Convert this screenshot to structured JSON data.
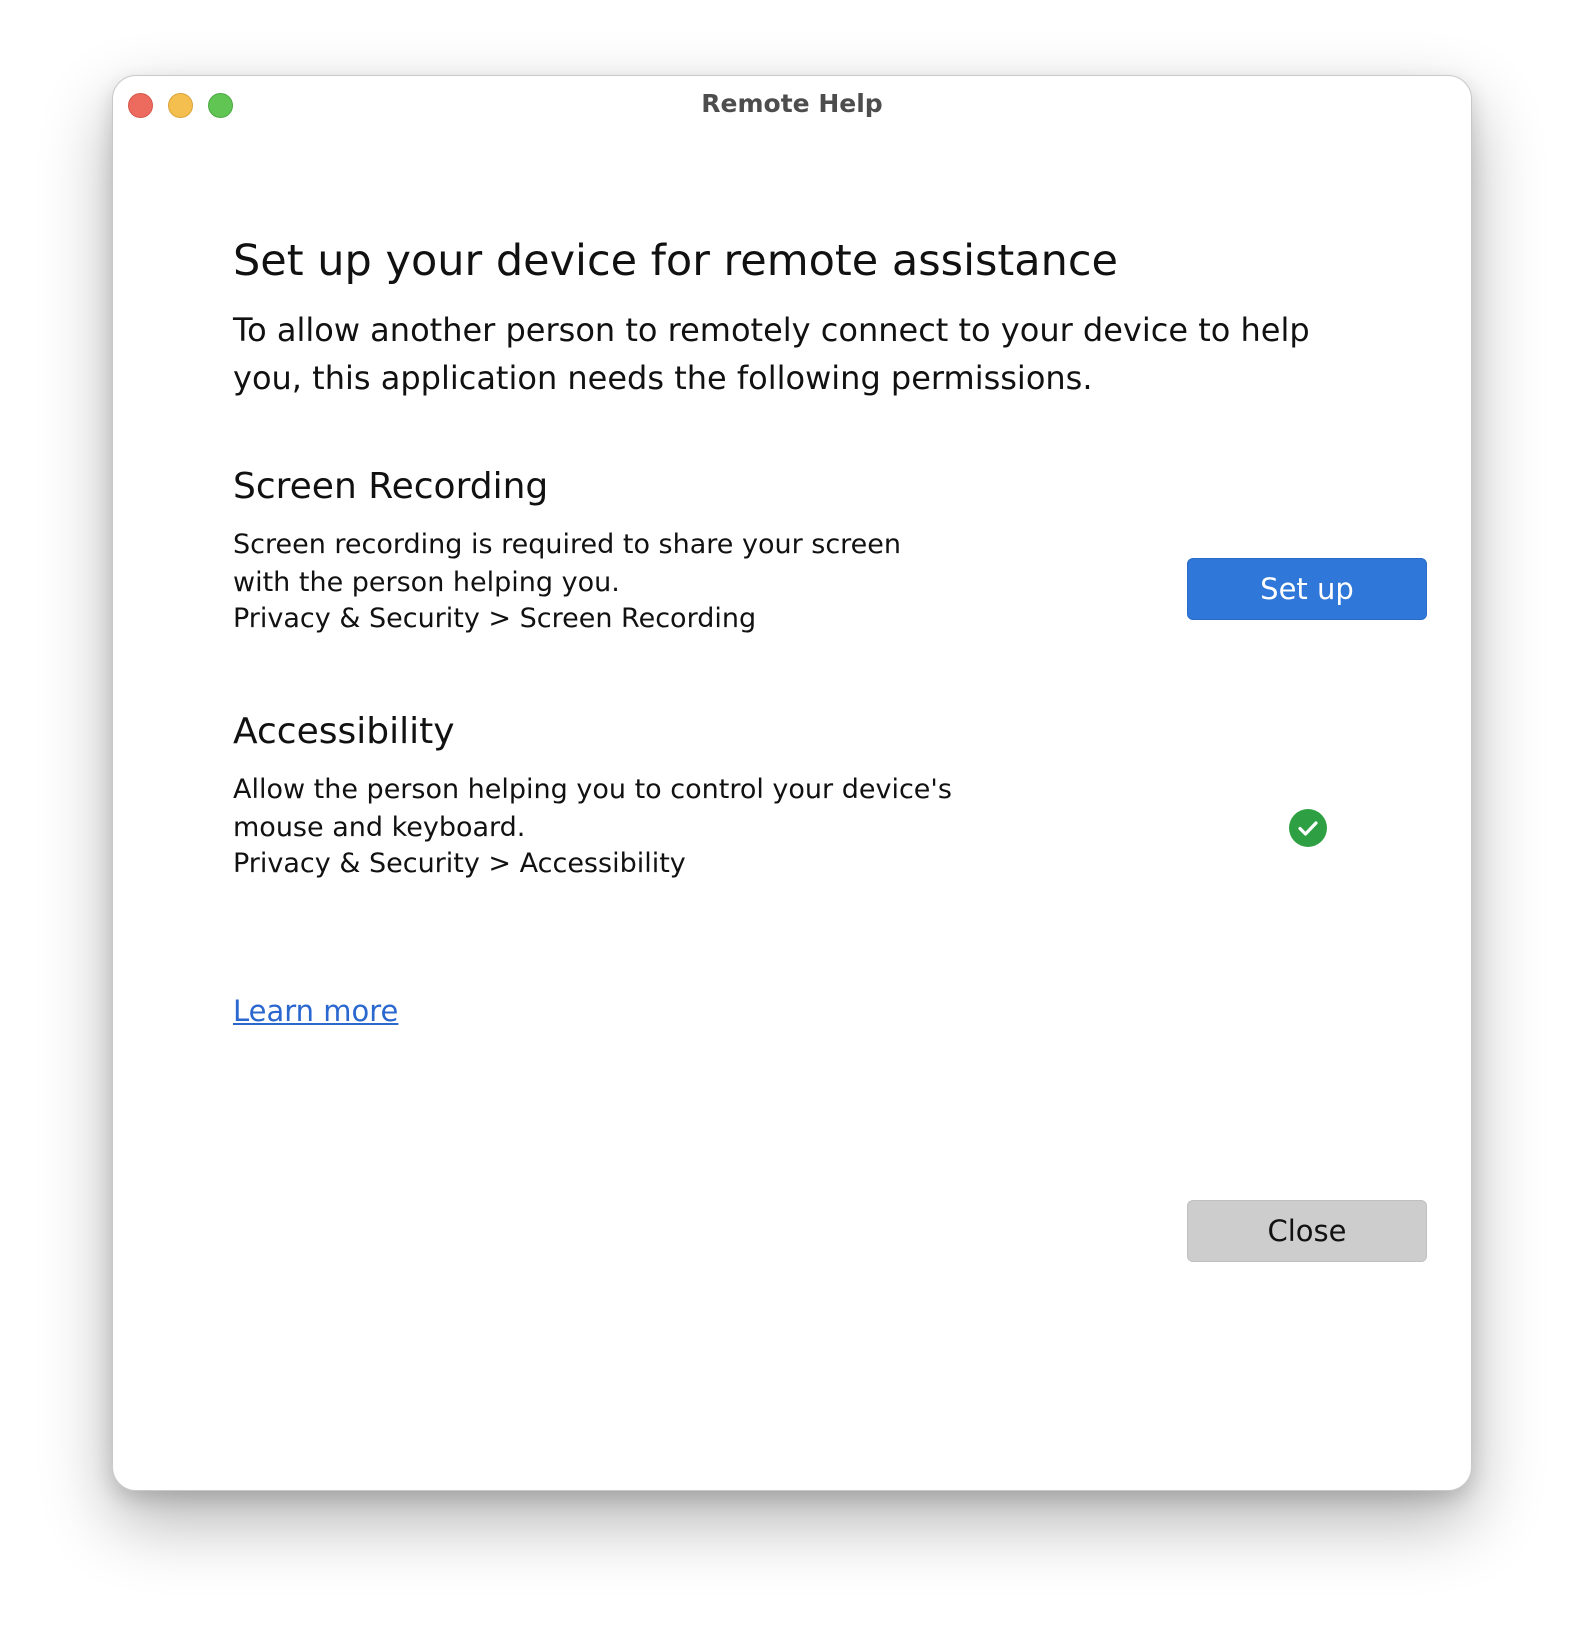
{
  "window": {
    "title": "Remote Help"
  },
  "main": {
    "heading": "Set up your device for remote assistance",
    "intro": "To allow another person to remotely connect to your device to help you, this application needs the following permissions."
  },
  "permissions": [
    {
      "title": "Screen Recording",
      "description": "Screen recording is required to share your screen with the person helping you.",
      "path": "Privacy & Security > Screen Recording",
      "action_label": "Set up",
      "status": "not_configured"
    },
    {
      "title": "Accessibility",
      "description": "Allow the person helping you to control your device's mouse and keyboard.",
      "path": "Privacy & Security > Accessibility",
      "status": "granted",
      "status_icon": "checkmark-circle-icon"
    }
  ],
  "links": {
    "learn_more": "Learn more"
  },
  "footer": {
    "close_label": "Close"
  },
  "colors": {
    "primary_button": "#2f77d9",
    "secondary_button": "#cdcdcd",
    "link": "#2a67cf",
    "success": "#2ea043",
    "traffic_close": "#ed6a5e",
    "traffic_minimize": "#f5bf4f",
    "traffic_maximize": "#61c554"
  }
}
